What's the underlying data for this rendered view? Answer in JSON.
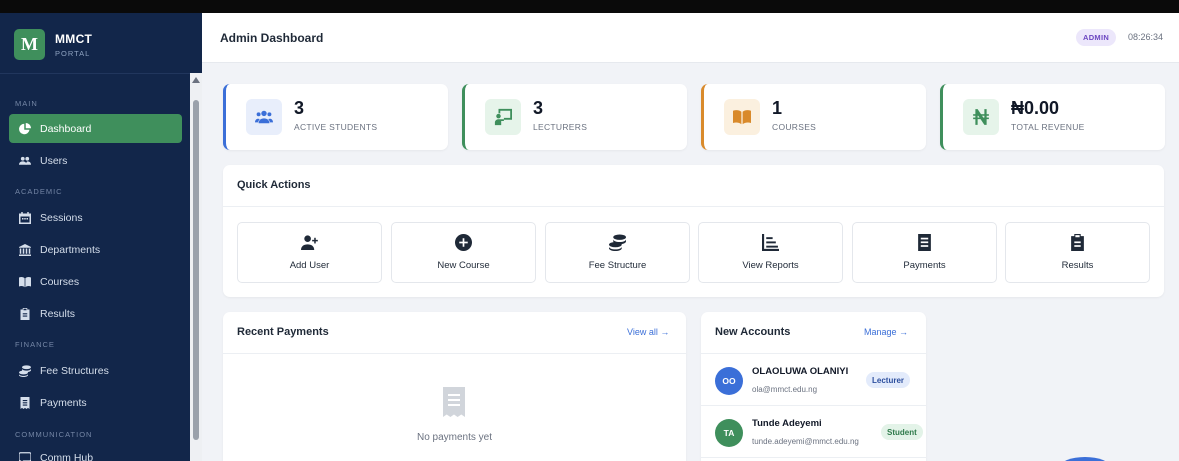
{
  "brand": {
    "logo_letter": "M",
    "title": "MMCT",
    "subtitle": "PORTAL"
  },
  "sidebar": {
    "sections": [
      {
        "label": "MAIN"
      },
      {
        "label": "ACADEMIC"
      },
      {
        "label": "FINANCE"
      },
      {
        "label": "COMMUNICATION"
      }
    ],
    "items": [
      {
        "label": "Dashboard",
        "icon": "pie-chart-icon",
        "active": true
      },
      {
        "label": "Users",
        "icon": "users-icon"
      },
      {
        "label": "Sessions",
        "icon": "calendar-icon"
      },
      {
        "label": "Departments",
        "icon": "building-icon"
      },
      {
        "label": "Courses",
        "icon": "book-icon"
      },
      {
        "label": "Results",
        "icon": "clipboard-icon"
      },
      {
        "label": "Fee Structures",
        "icon": "coins-icon"
      },
      {
        "label": "Payments",
        "icon": "receipt-icon"
      },
      {
        "label": "Comm Hub",
        "icon": "chat-icon"
      }
    ]
  },
  "header": {
    "title": "Admin Dashboard",
    "role_badge": "ADMIN",
    "time": "08:26:34"
  },
  "stats": [
    {
      "value": "3",
      "label": "ACTIVE STUDENTS",
      "icon": "users-icon",
      "accent": "#3b6fd8",
      "icon_bg": "#e8eefb"
    },
    {
      "value": "3",
      "label": "LECTURERS",
      "icon": "teacher-icon",
      "accent": "#3f8f5c",
      "icon_bg": "#e6f4ea"
    },
    {
      "value": "1",
      "label": "COURSES",
      "icon": "book-open-icon",
      "accent": "#d98a2b",
      "icon_bg": "#fbf0df"
    },
    {
      "value": "₦0.00",
      "label": "TOTAL REVENUE",
      "icon": "naira-icon",
      "accent": "#3f8f5c",
      "icon_bg": "#e6f4ea"
    }
  ],
  "quick_actions": {
    "title": "Quick Actions",
    "items": [
      {
        "label": "Add User",
        "icon": "user-plus-icon"
      },
      {
        "label": "New Course",
        "icon": "plus-circle-icon"
      },
      {
        "label": "Fee Structure",
        "icon": "coins-icon"
      },
      {
        "label": "View Reports",
        "icon": "chart-icon"
      },
      {
        "label": "Payments",
        "icon": "receipt-icon"
      },
      {
        "label": "Results",
        "icon": "clipboard-icon"
      }
    ]
  },
  "recent_payments": {
    "title": "Recent Payments",
    "link": "View all →",
    "empty": "No payments yet"
  },
  "new_accounts": {
    "title": "New Accounts",
    "link": "Manage →",
    "items": [
      {
        "initials": "OO",
        "name": "OLAOLUWA OLANIYI",
        "email": "ola@mmct.edu.ng",
        "role": "Lecturer",
        "avatar_color": "#3b6fd8",
        "role_bg": "#e3ebfb",
        "role_color": "#2d4f9e"
      },
      {
        "initials": "TA",
        "name": "Tunde Adeyemi",
        "email": "tunde.adeyemi@mmct.edu.ng",
        "role": "Student",
        "avatar_color": "#3f8f5c",
        "role_bg": "#e3f3e8",
        "role_color": "#2e7a4a"
      }
    ]
  },
  "colors": {
    "sidebar_bg": "#12264a",
    "accent_green": "#3f8f5c",
    "link_blue": "#3b6fd8",
    "main_bg": "#f1f3f7"
  }
}
